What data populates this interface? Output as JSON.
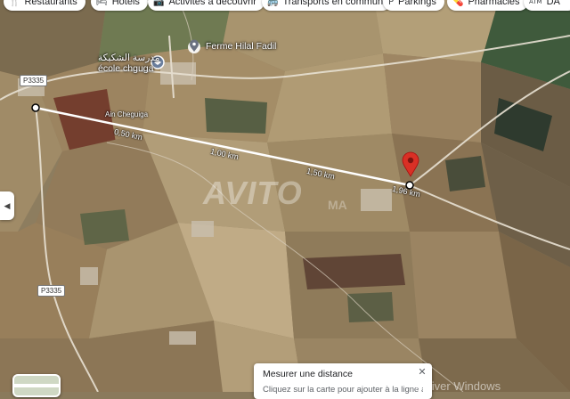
{
  "chips": [
    {
      "icon": "restaurant-icon",
      "glyph": "🍴",
      "label": "Restaurants"
    },
    {
      "icon": "hotel-icon",
      "glyph": "🛏",
      "label": "Hotels"
    },
    {
      "icon": "camera-icon",
      "glyph": "📷",
      "label": "Activités à découvrir"
    },
    {
      "icon": "bus-icon",
      "glyph": "🚌",
      "label": "Transports en commun"
    },
    {
      "icon": "parking-icon",
      "glyph": "P",
      "label": "Parkings"
    },
    {
      "icon": "pharmacy-icon",
      "glyph": "💊",
      "label": "Pharmacies"
    },
    {
      "icon": "atm-icon",
      "glyph": "ATM",
      "label": "DA"
    }
  ],
  "pois": {
    "farm": "Ferme Hilal Fadil",
    "school_ar": "مدرسة الشكيكة",
    "school_fr": "école chguga",
    "village": "Ain Cheguiga"
  },
  "roads": {
    "shield_top": "P3335",
    "shield_bottom": "P3335"
  },
  "measure_labels": [
    "0,50 km",
    "1,00 km",
    "1,50 km",
    "1,96 km"
  ],
  "measure_panel": {
    "title": "Mesurer une distance",
    "hint": "Cliquez sur la carte pour ajouter à la ligne au trajet",
    "close": "✕"
  },
  "side_tab_glyph": "◀",
  "watermark": {
    "brand": "AVITO",
    "suffix": "MA"
  },
  "os_overlay": "Activer Windows",
  "colors": {
    "pin": "#d93025",
    "measure_line": "#ffffff"
  }
}
